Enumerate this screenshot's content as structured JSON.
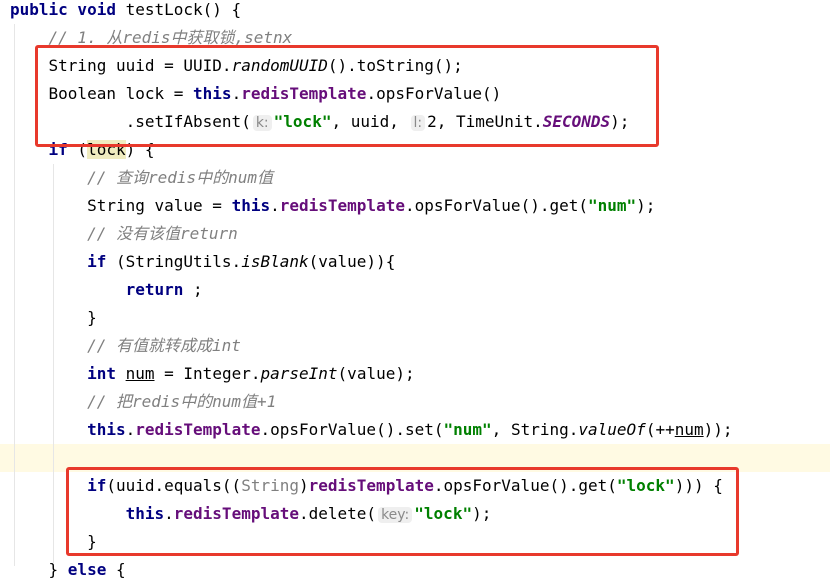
{
  "colors": {
    "highlight_box": "#e8392c",
    "keyword": "#000080",
    "field": "#660e7a",
    "string": "#008000",
    "comment": "#808080"
  },
  "lines": [
    [
      {
        "t": "kw",
        "v": "public void "
      },
      {
        "t": "",
        "v": "testLock() {"
      }
    ],
    [
      {
        "t": "",
        "v": "    "
      },
      {
        "t": "cmt",
        "v": "// 1. 从redis中获取锁,setnx"
      }
    ],
    [
      {
        "t": "",
        "v": "    String uuid = UUID."
      },
      {
        "t": "it",
        "v": "randomUUID"
      },
      {
        "t": "",
        "v": "().toString();"
      }
    ],
    [
      {
        "t": "",
        "v": "    Boolean lock = "
      },
      {
        "t": "kw",
        "v": "this"
      },
      {
        "t": "",
        "v": "."
      },
      {
        "t": "fld",
        "v": "redisTemplate"
      },
      {
        "t": "",
        "v": ".opsForValue()"
      }
    ],
    [
      {
        "t": "",
        "v": "            .setIfAbsent("
      },
      {
        "t": "hint",
        "v": "k:"
      },
      {
        "t": "str",
        "v": "\"lock\""
      },
      {
        "t": "",
        "v": ", uuid, "
      },
      {
        "t": "hint",
        "v": "l:"
      },
      {
        "t": "",
        "v": "2, TimeUnit."
      },
      {
        "t": "cst",
        "v": "SECONDS"
      },
      {
        "t": "",
        "v": ");"
      }
    ],
    [
      {
        "t": "",
        "v": "    "
      },
      {
        "t": "kw",
        "v": "if"
      },
      {
        "t": "",
        "v": " ("
      },
      {
        "t": "hl",
        "v": "lock"
      },
      {
        "t": "",
        "v": ") {"
      }
    ],
    [
      {
        "t": "",
        "v": "        "
      },
      {
        "t": "cmt",
        "v": "// 查询redis中的num值"
      }
    ],
    [
      {
        "t": "",
        "v": "        String value = "
      },
      {
        "t": "kw",
        "v": "this"
      },
      {
        "t": "",
        "v": "."
      },
      {
        "t": "fld",
        "v": "redisTemplate"
      },
      {
        "t": "",
        "v": ".opsForValue().get("
      },
      {
        "t": "str",
        "v": "\"num\""
      },
      {
        "t": "",
        "v": ");"
      }
    ],
    [
      {
        "t": "",
        "v": "        "
      },
      {
        "t": "cmt",
        "v": "// 没有该值return"
      }
    ],
    [
      {
        "t": "",
        "v": "        "
      },
      {
        "t": "kw",
        "v": "if"
      },
      {
        "t": "",
        "v": " (StringUtils."
      },
      {
        "t": "it",
        "v": "isBlank"
      },
      {
        "t": "",
        "v": "(value)){"
      }
    ],
    [
      {
        "t": "",
        "v": "            "
      },
      {
        "t": "kw",
        "v": "return"
      },
      {
        "t": "",
        "v": " ;"
      }
    ],
    [
      {
        "t": "",
        "v": "        }"
      }
    ],
    [
      {
        "t": "",
        "v": "        "
      },
      {
        "t": "cmt",
        "v": "// 有值就转成成int"
      }
    ],
    [
      {
        "t": "",
        "v": "        "
      },
      {
        "t": "kw",
        "v": "int"
      },
      {
        "t": "",
        "v": " "
      },
      {
        "t": "ul",
        "v": "num"
      },
      {
        "t": "",
        "v": " = Integer."
      },
      {
        "t": "it",
        "v": "parseInt"
      },
      {
        "t": "",
        "v": "(value);"
      }
    ],
    [
      {
        "t": "",
        "v": "        "
      },
      {
        "t": "cmt",
        "v": "// 把redis中的num值+1"
      }
    ],
    [
      {
        "t": "",
        "v": "        "
      },
      {
        "t": "kw",
        "v": "this"
      },
      {
        "t": "",
        "v": "."
      },
      {
        "t": "fld",
        "v": "redisTemplate"
      },
      {
        "t": "",
        "v": ".opsForValue().set("
      },
      {
        "t": "str",
        "v": "\"num\""
      },
      {
        "t": "",
        "v": ", String."
      },
      {
        "t": "it",
        "v": "valueOf"
      },
      {
        "t": "",
        "v": "(++"
      },
      {
        "t": "ul",
        "v": "num"
      },
      {
        "t": "",
        "v": "));"
      }
    ],
    [
      {
        "t": "",
        "v": ""
      }
    ],
    [
      {
        "t": "",
        "v": "        "
      },
      {
        "t": "kw",
        "v": "if"
      },
      {
        "t": "",
        "v": "(uuid.equals(("
      },
      {
        "t": "cast",
        "v": "String"
      },
      {
        "t": "",
        "v": ")"
      },
      {
        "t": "fld",
        "v": "redisTemplate"
      },
      {
        "t": "",
        "v": ".opsForValue().get("
      },
      {
        "t": "str",
        "v": "\"lock\""
      },
      {
        "t": "",
        "v": "))) {"
      }
    ],
    [
      {
        "t": "",
        "v": "            "
      },
      {
        "t": "kw",
        "v": "this"
      },
      {
        "t": "",
        "v": "."
      },
      {
        "t": "fld",
        "v": "redisTemplate"
      },
      {
        "t": "",
        "v": ".delete("
      },
      {
        "t": "hint",
        "v": "key:"
      },
      {
        "t": "str",
        "v": "\"lock\""
      },
      {
        "t": "",
        "v": ");"
      }
    ],
    [
      {
        "t": "",
        "v": "        }"
      }
    ],
    [
      {
        "t": "",
        "v": "    } "
      },
      {
        "t": "kw",
        "v": "else"
      },
      {
        "t": "",
        "v": " {"
      }
    ]
  ],
  "current_line": 16
}
